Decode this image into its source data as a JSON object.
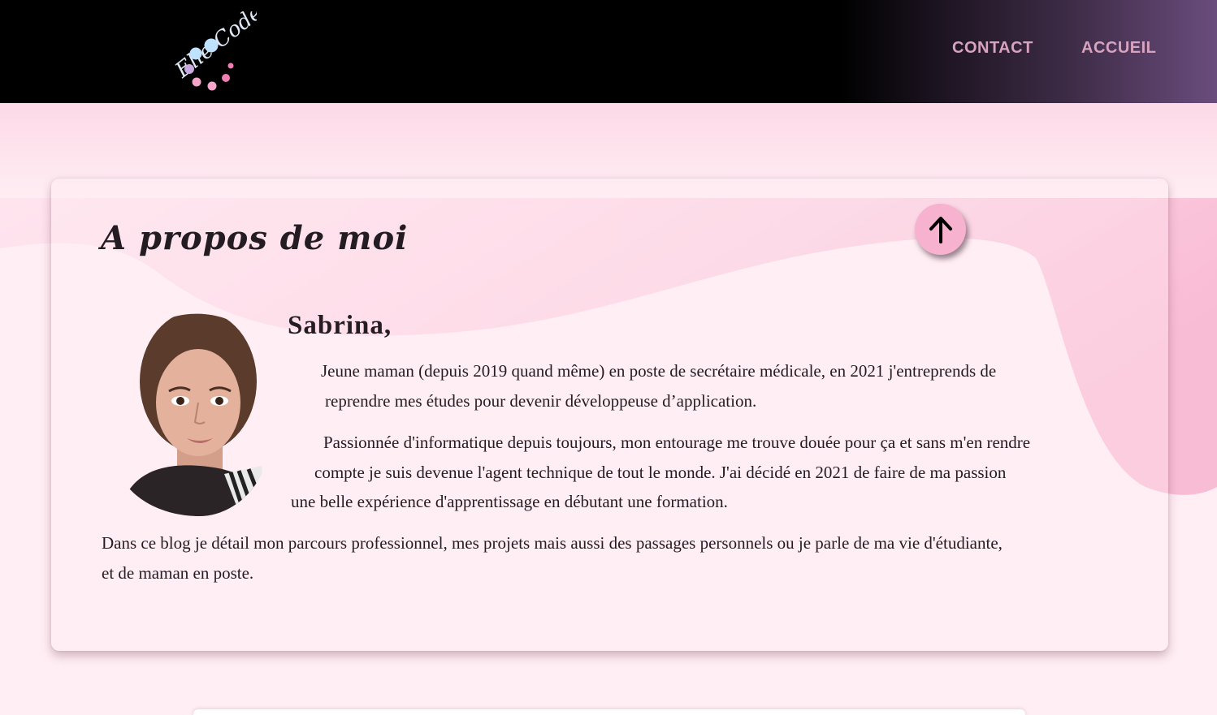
{
  "header": {
    "logo_text": "Elle Code",
    "nav": [
      {
        "label": "CONTACT"
      },
      {
        "label": "ACCUEIL"
      }
    ]
  },
  "about": {
    "title": "A propos de moi",
    "name": "Sabrina,",
    "paragraph1": [
      "Jeune maman (depuis 2019 quand même) en poste de secrétaire médicale, en 2021 j'entreprends de",
      "reprendre mes études pour devenir développeuse d’application."
    ],
    "paragraph2": [
      "Passionnée d'informatique depuis toujours, mon entourage me trouve douée pour ça et sans m'en rendre",
      "compte je suis devenue l'agent technique de tout le monde. J'ai décidé en 2021 de faire de ma passion",
      "une belle expérience d'apprentissage en débutant une formation."
    ],
    "paragraph3": [
      "Dans ce blog je détail mon parcours professionnel, mes projets mais aussi des passages personnels ou je parle de ma vie d'étudiante,",
      "et de maman en poste."
    ]
  },
  "icons": {
    "scroll_top": "arrow-up-icon"
  },
  "colors": {
    "nav_text": "#d7a3bf",
    "accent_pink": "#f6b2cf",
    "page_bg": "#ffeef4",
    "header_bg": "#000000"
  }
}
